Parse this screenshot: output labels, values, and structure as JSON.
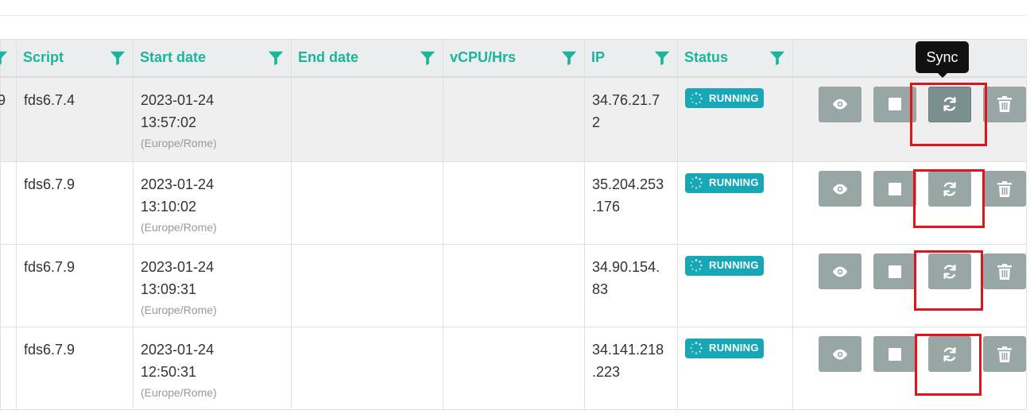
{
  "columns": [
    {
      "key": "prev",
      "label": ""
    },
    {
      "key": "script",
      "label": "Script"
    },
    {
      "key": "start_date",
      "label": "Start date"
    },
    {
      "key": "end_date",
      "label": "End date"
    },
    {
      "key": "vcpu",
      "label": "vCPU/Hrs"
    },
    {
      "key": "ip",
      "label": "IP"
    },
    {
      "key": "status",
      "label": "Status"
    },
    {
      "key": "actions",
      "label": ""
    }
  ],
  "rows": [
    {
      "prev": "9",
      "script": "fds6.7.4",
      "start_date": "2023-01-24",
      "start_time": "13:57:02",
      "timezone": "(Europe/Rome)",
      "end_date": "",
      "vcpu": "",
      "ip_line1": "34.76.21.7",
      "ip_line2": "2",
      "status": "RUNNING"
    },
    {
      "prev": "",
      "script": "fds6.7.9",
      "start_date": "2023-01-24",
      "start_time": "13:10:02",
      "timezone": "(Europe/Rome)",
      "end_date": "",
      "vcpu": "",
      "ip_line1": "35.204.253",
      "ip_line2": ".176",
      "status": "RUNNING"
    },
    {
      "prev": "",
      "script": "fds6.7.9",
      "start_date": "2023-01-24",
      "start_time": "13:09:31",
      "timezone": "(Europe/Rome)",
      "end_date": "",
      "vcpu": "",
      "ip_line1": "34.90.154.",
      "ip_line2": "83",
      "status": "RUNNING"
    },
    {
      "prev": "",
      "script": "fds6.7.9",
      "start_date": "2023-01-24",
      "start_time": "12:50:31",
      "timezone": "(Europe/Rome)",
      "end_date": "",
      "vcpu": "",
      "ip_line1": "34.141.218",
      "ip_line2": ".223",
      "status": "RUNNING"
    }
  ],
  "actions": [
    {
      "name": "view",
      "icon": "eye-icon"
    },
    {
      "name": "stop",
      "icon": "stop-square-icon"
    },
    {
      "name": "sync",
      "icon": "sync-icon"
    },
    {
      "name": "delete",
      "icon": "trash-icon"
    }
  ],
  "tooltip": {
    "text": "Sync"
  },
  "colors": {
    "accent": "#1bb59a",
    "header_bg": "#eaeeee",
    "status_running": "#17a8b8",
    "action_button": "#98a6a6",
    "highlight": "#e0151b"
  }
}
